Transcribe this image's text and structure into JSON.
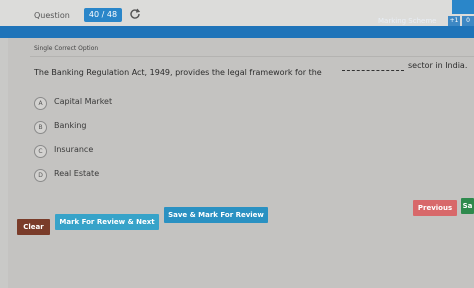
{
  "header": {
    "question_label": "Question",
    "counter": "40 / 48",
    "marking_scheme": "Marking Scheme",
    "mini_buttons": [
      "+1",
      "0"
    ]
  },
  "section": {
    "title": "Single Correct Option"
  },
  "question": {
    "text": "The Banking Regulation Act, 1949, provides the legal framework for the",
    "tail": "sector in India."
  },
  "options": [
    {
      "letter": "A",
      "text": "Capital Market"
    },
    {
      "letter": "B",
      "text": "Banking"
    },
    {
      "letter": "C",
      "text": "Insurance"
    },
    {
      "letter": "D",
      "text": "Real Estate"
    }
  ],
  "buttons": {
    "clear": "Clear",
    "mark_review_next": "Mark For Review & Next",
    "save_mark_review": "Save & Mark For Review",
    "previous": "Previous",
    "save_next": "Sa"
  },
  "colors": {
    "primary_blue": "#1f74b9",
    "clear": "#7a3c2a",
    "previous": "#d8686a",
    "save_next": "#2e8a4d"
  }
}
